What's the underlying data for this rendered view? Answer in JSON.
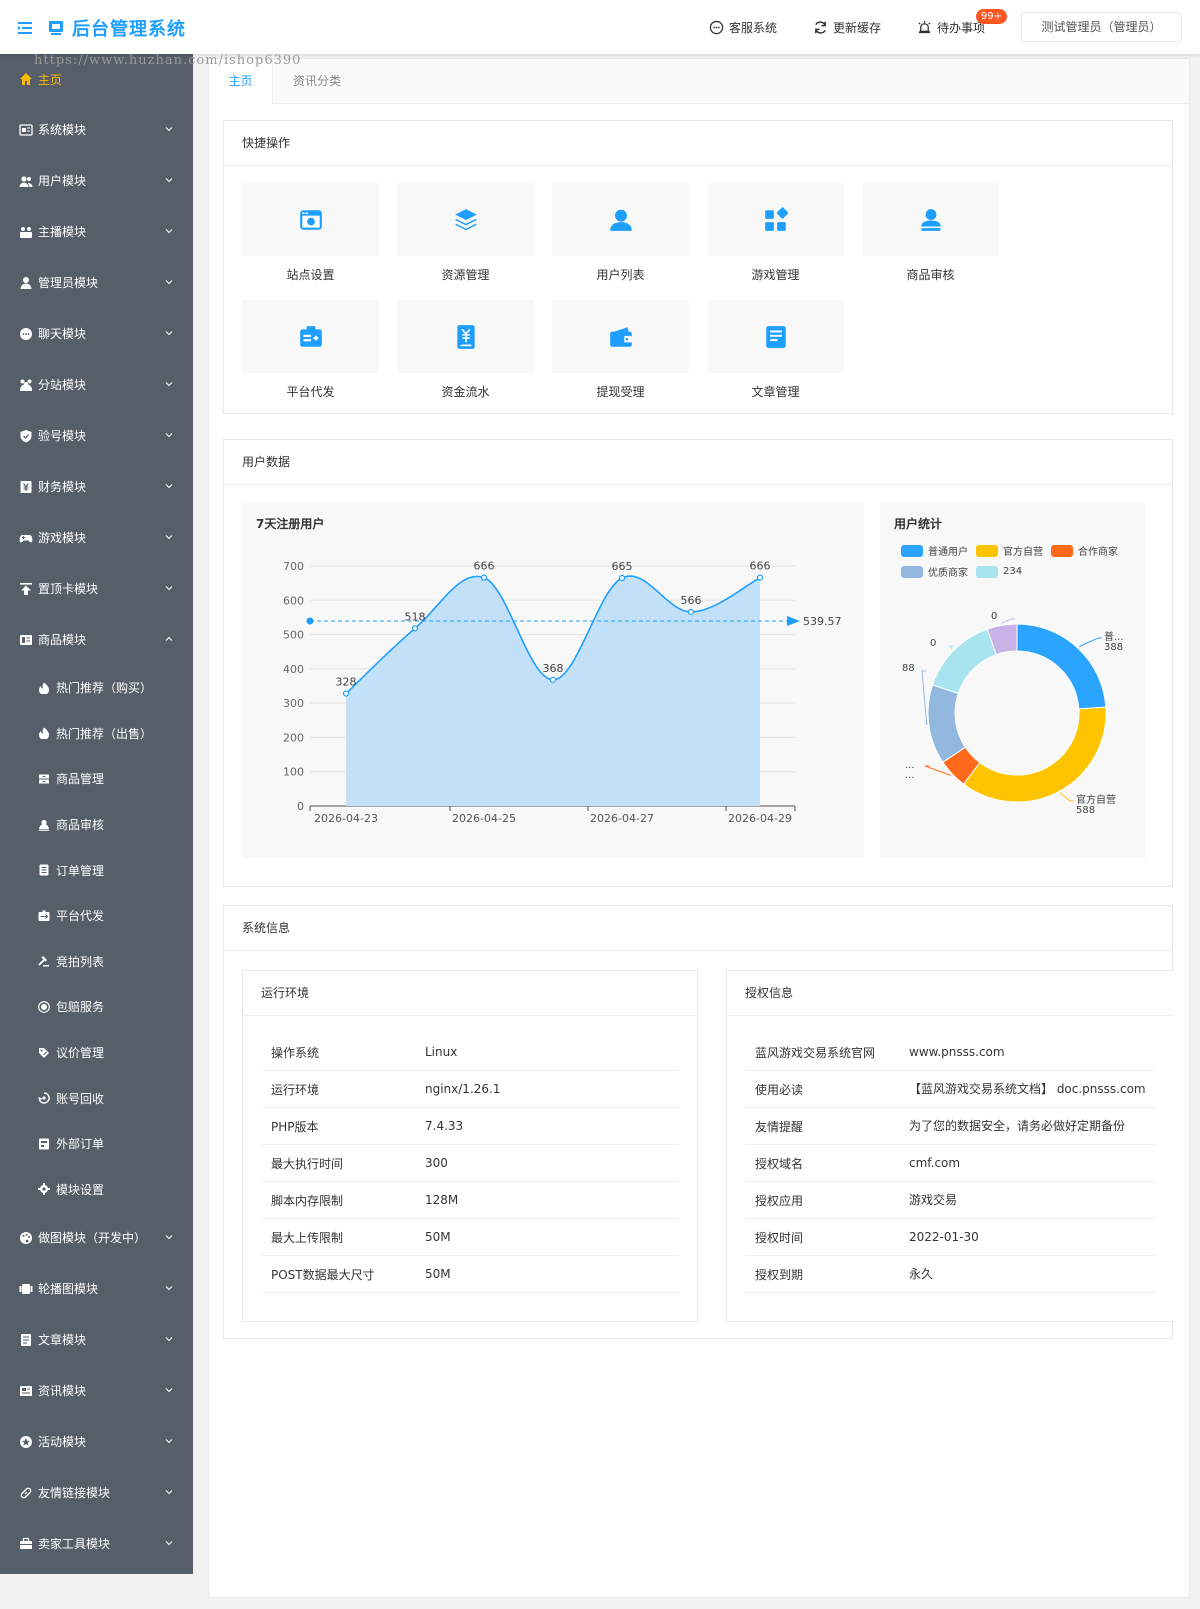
{
  "header": {
    "title": "后台管理系统",
    "service": "客服系统",
    "refresh": "更新缓存",
    "todo": "待办事项",
    "todo_badge": "99+",
    "user": "测试管理员（管理员）"
  },
  "watermark": "https://www.huzhan.com/ishop6390",
  "colors": {
    "accent": "#1e9fff",
    "sidebar": "#565e69",
    "active": "#ffb800"
  },
  "sidebar": {
    "items": [
      {
        "label": "主页",
        "icon": "home-icon"
      },
      {
        "label": "系统模块",
        "icon": "system-icon"
      },
      {
        "label": "用户模块",
        "icon": "users-icon"
      },
      {
        "label": "主播模块",
        "icon": "anchor-icon"
      },
      {
        "label": "管理员模块",
        "icon": "admin-icon"
      },
      {
        "label": "聊天模块",
        "icon": "chat-icon"
      },
      {
        "label": "分站模块",
        "icon": "branch-icon"
      },
      {
        "label": "验号模块",
        "icon": "shield-icon"
      },
      {
        "label": "财务模块",
        "icon": "finance-icon"
      },
      {
        "label": "游戏模块",
        "icon": "gamepad-icon"
      },
      {
        "label": "置顶卡模块",
        "icon": "pin-top-icon"
      },
      {
        "label": "商品模块",
        "icon": "goods-icon"
      }
    ],
    "sub_items": [
      {
        "label": "热门推荐（购买）",
        "icon": "fire-icon"
      },
      {
        "label": "热门推荐（出售）",
        "icon": "fire-icon"
      },
      {
        "label": "商品管理",
        "icon": "box-icon"
      },
      {
        "label": "商品审核",
        "icon": "review-icon"
      },
      {
        "label": "订单管理",
        "icon": "order-icon"
      },
      {
        "label": "平台代发",
        "icon": "delivery-icon"
      },
      {
        "label": "竞拍列表",
        "icon": "auction-icon"
      },
      {
        "label": "包赔服务",
        "icon": "insurance-icon"
      },
      {
        "label": "议价管理",
        "icon": "bargain-icon"
      },
      {
        "label": "账号回收",
        "icon": "recycle-icon"
      },
      {
        "label": "外部订单",
        "icon": "external-icon"
      },
      {
        "label": "模块设置",
        "icon": "gear-icon"
      }
    ],
    "bottom_items": [
      {
        "label": "做图模块（开发中）",
        "icon": "palette-icon"
      },
      {
        "label": "轮播图模块",
        "icon": "carousel-icon"
      },
      {
        "label": "文章模块",
        "icon": "article-icon"
      },
      {
        "label": "资讯模块",
        "icon": "news-icon"
      },
      {
        "label": "活动模块",
        "icon": "activity-icon"
      },
      {
        "label": "友情链接模块",
        "icon": "link-icon"
      },
      {
        "label": "卖家工具模块",
        "icon": "toolbox-icon"
      }
    ]
  },
  "tabs": [
    {
      "label": "主页"
    },
    {
      "label": "资讯分类"
    }
  ],
  "quick": {
    "title": "快捷操作",
    "items": [
      {
        "label": "站点设置",
        "icon": "browser-icon"
      },
      {
        "label": "资源管理",
        "icon": "layers-icon"
      },
      {
        "label": "用户列表",
        "icon": "user-icon"
      },
      {
        "label": "游戏管理",
        "icon": "apps-icon"
      },
      {
        "label": "商品审核",
        "icon": "user-check-icon"
      },
      {
        "label": "平台代发",
        "icon": "shipping-icon"
      },
      {
        "label": "资金流水",
        "icon": "yuan-doc-icon"
      },
      {
        "label": "提现受理",
        "icon": "wallet-icon"
      },
      {
        "label": "文章管理",
        "icon": "document-icon"
      }
    ]
  },
  "user_data": {
    "title": "用户数据",
    "line_title": "7天注册用户",
    "pie_title": "用户统计"
  },
  "chart_data": [
    {
      "type": "area",
      "title": "7天注册用户",
      "x": [
        "2026-04-23",
        "2026-04-24",
        "2026-04-25",
        "2026-04-26",
        "2026-04-27",
        "2026-04-28",
        "2026-04-29"
      ],
      "x_ticks": [
        "2026-04-23",
        "2026-04-25",
        "2026-04-27",
        "2026-04-29"
      ],
      "values": [
        328,
        518,
        666,
        368,
        665,
        566,
        666
      ],
      "average": 539.57,
      "ylim": [
        0,
        700
      ],
      "yticks": [
        0,
        100,
        200,
        300,
        400,
        500,
        600,
        700
      ],
      "color": "#1e9fff",
      "fill": "#c2e0f7",
      "grid": true
    },
    {
      "type": "pie",
      "title": "用户统计",
      "legend_position": "top",
      "slices": [
        {
          "name": "普通用户",
          "value": 388,
          "label": "普...",
          "value_label": "388",
          "color": "#2ba4ff"
        },
        {
          "name": "官方自营",
          "value": 588,
          "label": "官方自营",
          "value_label": "588",
          "color": "#ffc400"
        },
        {
          "name": "合作商家",
          "value": 88,
          "label": "...",
          "value_label": "...",
          "color": "#ff6a1a"
        },
        {
          "name": "优质商家",
          "value": 234,
          "label": "",
          "value_label": "88",
          "color": "#93b8e0"
        },
        {
          "name": "234",
          "value": 234,
          "label": "",
          "value_label": "0",
          "color": "#a8e4f0"
        },
        {
          "name": "",
          "value": 88,
          "label": "",
          "value_label": "0",
          "color": "#c9b3e6"
        }
      ]
    }
  ],
  "system_info": {
    "title": "系统信息",
    "env_title": "运行环境",
    "env_rows": [
      {
        "k": "操作系统",
        "v": "Linux"
      },
      {
        "k": "运行环境",
        "v": "nginx/1.26.1"
      },
      {
        "k": "PHP版本",
        "v": "7.4.33"
      },
      {
        "k": "最大执行时间",
        "v": "300"
      },
      {
        "k": "脚本内存限制",
        "v": "128M"
      },
      {
        "k": "最大上传限制",
        "v": "50M"
      },
      {
        "k": "POST数据最大尺寸",
        "v": "50M"
      }
    ],
    "auth_title": "授权信息",
    "auth_rows": [
      {
        "k": "蓝风游戏交易系统官网",
        "v": "www.pnsss.com"
      },
      {
        "k": "使用必读",
        "v": "【蓝风游戏交易系统文档】 doc.pnsss.com"
      },
      {
        "k": "友情提醒",
        "v": "为了您的数据安全，请务必做好定期备份"
      },
      {
        "k": "授权域名",
        "v": "cmf.com"
      },
      {
        "k": "授权应用",
        "v": "游戏交易"
      },
      {
        "k": "授权时间",
        "v": "2022-01-30"
      },
      {
        "k": "授权到期",
        "v": "永久"
      }
    ]
  }
}
